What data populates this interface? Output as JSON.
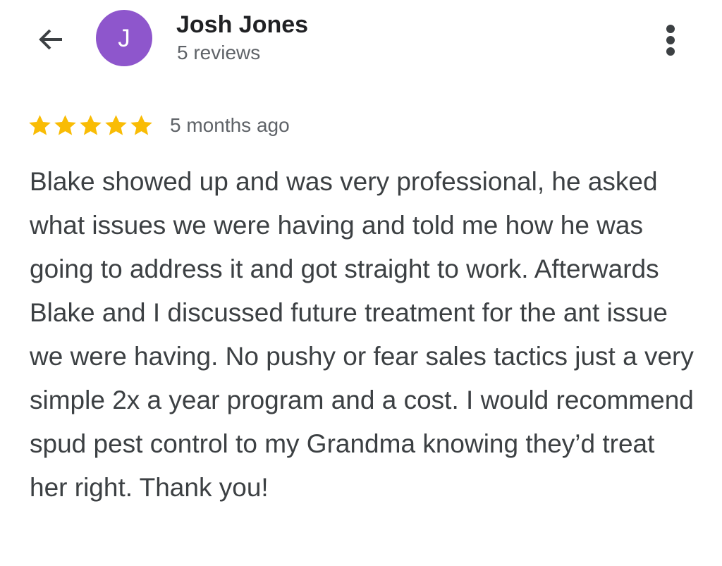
{
  "header": {
    "back_icon": "arrow-left-icon",
    "avatar": {
      "initial": "J",
      "color": "#8e56cc"
    },
    "reviewer_name": "Josh Jones",
    "review_count": "5 reviews",
    "more_icon": "more-vertical-icon"
  },
  "review": {
    "rating": 5,
    "max_rating": 5,
    "star_color": "#f9bc05",
    "time_ago": "5 months ago",
    "text": "Blake showed up and was very professional, he asked what issues we were having and told me how he was going to address it and got straight to work. Afterwards Blake and I discussed future treatment for the ant issue we were having. No pushy or fear sales tactics just a very simple 2x a year program and a cost. I would recommend spud pest control to my Grandma knowing they’d treat her right. Thank you!"
  }
}
